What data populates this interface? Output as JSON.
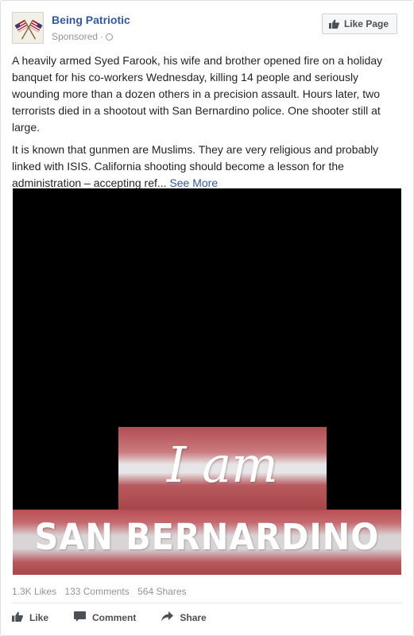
{
  "page": {
    "name": "Being Patriotic",
    "sponsored": "Sponsored",
    "dot": "·",
    "like_page_button": "Like Page"
  },
  "post": {
    "paragraph_1": "A heavily armed Syed Farook, his wife and brother opened fire on a holiday banquet for his co-workers Wednesday, killing 14 people and seriously wounding more than a dozen others in a precision assault. Hours later, two terrorists died in a shootout with San Bernardino police. One shooter still at large.",
    "paragraph_2": "It is known that gunmen are Muslims. They are very religious and probably linked with ISIS. California shooting should become a lesson for the administration – accepting ref...",
    "see_more": "See More"
  },
  "image": {
    "script_text": "I am",
    "headline": "SAN BERNARDINO"
  },
  "stats": {
    "likes": "1.3K Likes",
    "comments": "133 Comments",
    "shares": "564 Shares"
  },
  "actions": {
    "like": "Like",
    "comment": "Comment",
    "share": "Share"
  },
  "colors": {
    "link": "#365899",
    "text": "#1d2129",
    "muted": "#90949c"
  }
}
